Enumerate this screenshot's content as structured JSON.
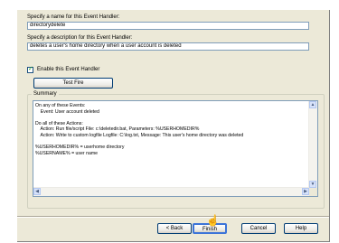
{
  "form": {
    "name_label": "Specify a name for this Event Handler:",
    "name_value": "directorydelete",
    "desc_label": "Specify a description for this Event Handler:",
    "desc_value": "deletes a user's home directory when a user account is deleted",
    "enable_label": "Enable this Event Handler",
    "enable_checked": true,
    "test_button": "Test Fire"
  },
  "summary": {
    "legend": "Summary",
    "lines": [
      "On any of these Events:",
      "    Event: User account deleted",
      "",
      "Do all of these Actions:",
      "    Action: Run file/script File: c:\\deletedir.bat, Parameters: %USERHOMEDIR%",
      "    Action: Write to custom logfile Logfile: C:\\log.txt, Message: This user's home directory was deleted",
      "",
      "%USERHOMEDIR% = userhome directory",
      "%USERNAME% = user name"
    ]
  },
  "footer": {
    "back": "< Back",
    "finish": "Finish",
    "cancel": "Cancel",
    "help": "Help"
  }
}
